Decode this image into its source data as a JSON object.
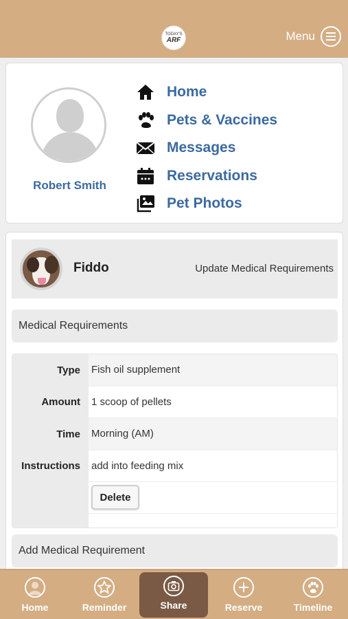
{
  "header": {
    "logo_line1": "TODAY'S",
    "logo_line2": "ARF",
    "menu_label": "Menu"
  },
  "profile": {
    "user_name": "Robert Smith"
  },
  "nav": {
    "items": [
      {
        "label": "Home",
        "icon": "house-icon"
      },
      {
        "label": "Pets & Vaccines",
        "icon": "paw-icon"
      },
      {
        "label": "Messages",
        "icon": "envelope-icon"
      },
      {
        "label": "Reservations",
        "icon": "calendar-icon"
      },
      {
        "label": "Pet Photos",
        "icon": "photos-icon"
      }
    ]
  },
  "pet": {
    "name": "Fiddo",
    "action_label": "Update Medical Requirements"
  },
  "medical": {
    "section_title": "Medical Requirements",
    "rows": [
      {
        "label": "Type",
        "value": "Fish oil supplement"
      },
      {
        "label": "Amount",
        "value": "1 scoop of pellets"
      },
      {
        "label": "Time",
        "value": "Morning (AM)"
      },
      {
        "label": "Instructions",
        "value": "add into feeding mix"
      }
    ],
    "delete_label": "Delete",
    "add_label": "Add Medical Requirement"
  },
  "tabs": [
    {
      "label": "Home",
      "icon": "user-icon"
    },
    {
      "label": "Reminder",
      "icon": "star-icon"
    },
    {
      "label": "Share",
      "icon": "camera-icon"
    },
    {
      "label": "Reserve",
      "icon": "plus-icon"
    },
    {
      "label": "Timeline",
      "icon": "paw-icon"
    }
  ],
  "colors": {
    "brand": "#d4ad83",
    "active_tab": "#7a5a45",
    "link": "#3b6aa0"
  }
}
